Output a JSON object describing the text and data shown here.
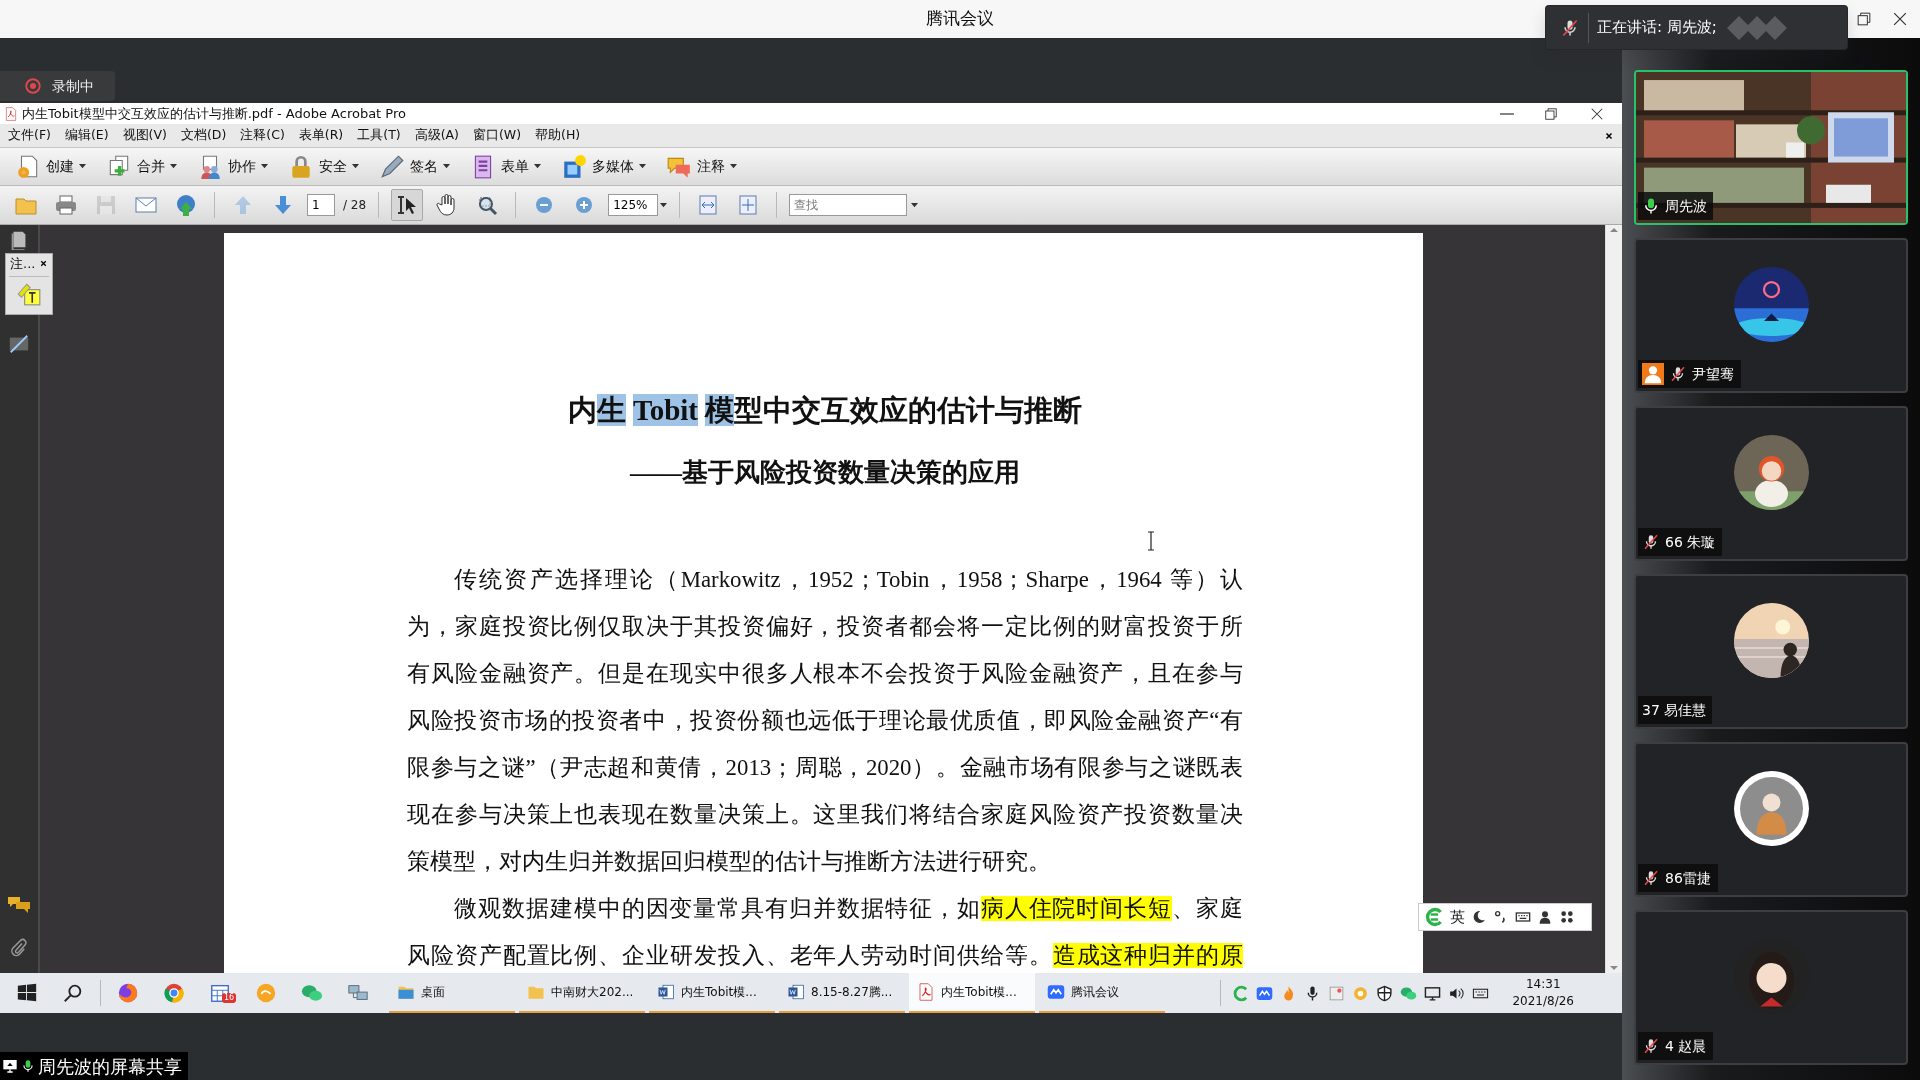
{
  "meeting": {
    "title": "腾讯会议",
    "recording": "录制中",
    "speaking": "正在讲话: 周先波;"
  },
  "acrobat": {
    "title": "内生Tobit模型中交互效应的估计与推断.pdf - Adobe Acrobat Pro",
    "menu": [
      "文件(F)",
      "编辑(E)",
      "视图(V)",
      "文档(D)",
      "注释(C)",
      "表单(R)",
      "工具(T)",
      "高级(A)",
      "窗口(W)",
      "帮助(H)"
    ],
    "task_buttons": [
      "创建",
      "合并",
      "协作",
      "安全",
      "签名",
      "表单",
      "多媒体",
      "注释"
    ],
    "file_tools": [
      {
        "disabled": false
      },
      {
        "disabled": false
      },
      {
        "disabled": true
      },
      {
        "disabled": false
      },
      {
        "disabled": false
      }
    ],
    "page_nav": [
      {
        "disabled": true
      },
      {
        "disabled": false
      }
    ],
    "page_number": "1",
    "page_count": "/ 28",
    "view_tools": [
      {
        "selected": true
      },
      {
        "selected": false
      },
      {
        "selected": false
      }
    ],
    "zoom": "125%",
    "find_placeholder": "查找",
    "palette": {
      "title": "注..."
    },
    "document": {
      "title": [
        {
          "text": "内",
          "selected": false
        },
        {
          "text": "生",
          "selected": true
        },
        {
          "text": "Tobit",
          "selected": true
        },
        {
          "text": "模",
          "selected": true
        },
        {
          "text": "型中交互效应的估计与推断",
          "selected": false
        }
      ],
      "subtitle": "——基于风险投资数量决策的应用",
      "paragraphs": [
        {
          "complete": true,
          "lines": [
            [
              {
                "text": "传统资产选择理论（Markowitz，1952；Tobin，1958；Sharpe，1964 等）认",
                "highlighted": false
              }
            ],
            [
              {
                "text": "为，家庭投资比例仅取决于其投资偏好，投资者都会将一定比例的财富投资于所",
                "highlighted": false
              }
            ],
            [
              {
                "text": "有风险金融资产。但是在现实中很多人根本不会投资于风险金融资产，且在参与",
                "highlighted": false
              }
            ],
            [
              {
                "text": "风险投资市场的投资者中，投资份额也远低于理论最优质值，即风险金融资产“有",
                "highlighted": false
              }
            ],
            [
              {
                "text": "限参与之谜”（尹志超和黄倩，2013；周聪，2020）。金融市场有限参与之谜既表",
                "highlighted": false
              }
            ],
            [
              {
                "text": "现在参与决策上也表现在数量决策上。这里我们将结合家庭风险资产投资数量决",
                "highlighted": false
              }
            ],
            [
              {
                "text": "策模型，对内生归并数据回归模型的估计与推断方法进行研究。",
                "highlighted": false
              }
            ]
          ]
        },
        {
          "complete": false,
          "lines": [
            [
              {
                "text": "微观数据建模中的因变量常具有归并数据特征，如",
                "highlighted": false
              },
              {
                "text": "病人住院时间长短",
                "highlighted": true
              },
              {
                "text": "、家庭",
                "highlighted": false
              }
            ],
            [
              {
                "text": "风险资产配置比例、企业研发投入、老年人劳动时间供给等。",
                "highlighted": false
              },
              {
                "text": "造成这种归并的原",
                "highlighted": true
              }
            ]
          ]
        }
      ]
    }
  },
  "ime": {
    "mode": "英"
  },
  "taskbar": {
    "calendar_badge": "16",
    "tasks": [
      {
        "label": "桌面",
        "selected": false
      },
      {
        "label": "中南财大202...",
        "selected": false
      },
      {
        "label": "内生Tobit模...",
        "selected": false
      },
      {
        "label": "8.15-8.27腾...",
        "selected": false
      },
      {
        "label": "内生Tobit模...",
        "selected": true
      },
      {
        "label": "腾讯会议",
        "selected": false
      }
    ],
    "time": "14:31",
    "date": "2021/8/26"
  },
  "share_label": "周先波的屏幕共享",
  "participants": [
    {
      "name": "周先波",
      "mic_visible": true,
      "muted": false,
      "video": true,
      "speaking": true,
      "badge": false
    },
    {
      "name": "尹望骞",
      "mic_visible": true,
      "muted": true,
      "video": false,
      "speaking": false,
      "badge": true
    },
    {
      "name": "66 朱璇",
      "mic_visible": true,
      "muted": true,
      "video": false,
      "speaking": false,
      "badge": false
    },
    {
      "name": "37 易佳慧",
      "mic_visible": false,
      "muted": false,
      "video": false,
      "speaking": false,
      "badge": false
    },
    {
      "name": "86雷捷",
      "mic_visible": true,
      "muted": true,
      "video": false,
      "speaking": false,
      "badge": false
    },
    {
      "name": "4 赵晨",
      "mic_visible": true,
      "muted": true,
      "video": false,
      "speaking": false,
      "badge": false
    }
  ]
}
